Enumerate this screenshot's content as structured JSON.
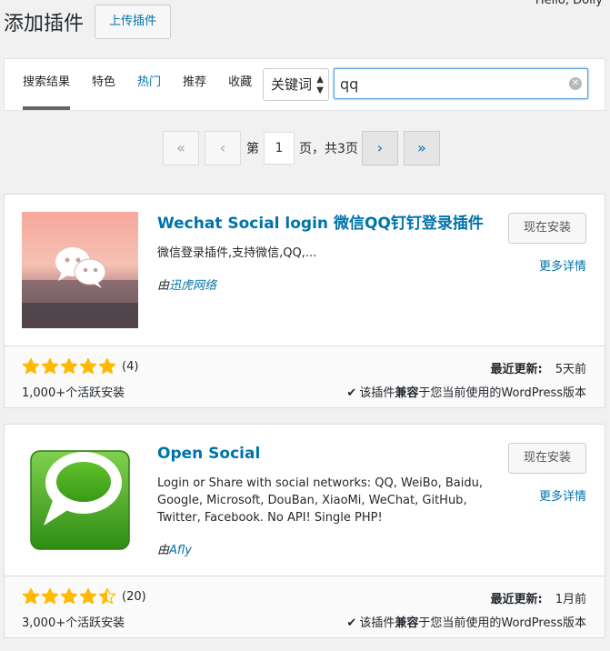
{
  "greeting": "Hello, Dolly",
  "header": {
    "title": "添加插件",
    "upload_label": "上传插件"
  },
  "filters": {
    "tabs": [
      {
        "label": "搜索结果"
      },
      {
        "label": "特色"
      },
      {
        "label": "热门"
      },
      {
        "label": "推荐"
      },
      {
        "label": "收藏"
      }
    ],
    "search_type": "关键词",
    "search_value": "qq"
  },
  "pagination": {
    "first": "«",
    "prev": "‹",
    "page_prefix": "第",
    "current": "1",
    "page_suffix": "页，共3页",
    "next": "›",
    "last": "»"
  },
  "plugins": [
    {
      "name": "Wechat Social login 微信QQ钉钉登录插件",
      "desc": "微信登录插件,支持微信,QQ,...",
      "author_prefix": "由",
      "author": "迅虎网络",
      "install_label": "现在安装",
      "details_label": "更多详情",
      "rating": 5,
      "rating_count": "(4)",
      "installs": "1,000+个活跃安装",
      "updated_label": "最近更新:",
      "updated_value": "5天前",
      "compat_prefix": "该插件",
      "compat_bold": "兼容",
      "compat_suffix": "于您当前使用的WordPress版本"
    },
    {
      "name": "Open Social",
      "desc": "Login or Share with social networks: QQ, WeiBo, Baidu, Google, Microsoft, DouBan, XiaoMi, WeChat, GitHub, Twitter, Facebook. No API! Single PHP!",
      "author_prefix": "由",
      "author": "Afly",
      "install_label": "现在安装",
      "details_label": "更多详情",
      "rating": 4.5,
      "rating_count": "(20)",
      "installs": "3,000+个活跃安装",
      "updated_label": "最近更新:",
      "updated_value": "1月前",
      "compat_prefix": "该插件",
      "compat_bold": "兼容",
      "compat_suffix": "于您当前使用的WordPress版本"
    }
  ],
  "colors": {
    "link": "#0073aa",
    "star": "#ffb900"
  }
}
